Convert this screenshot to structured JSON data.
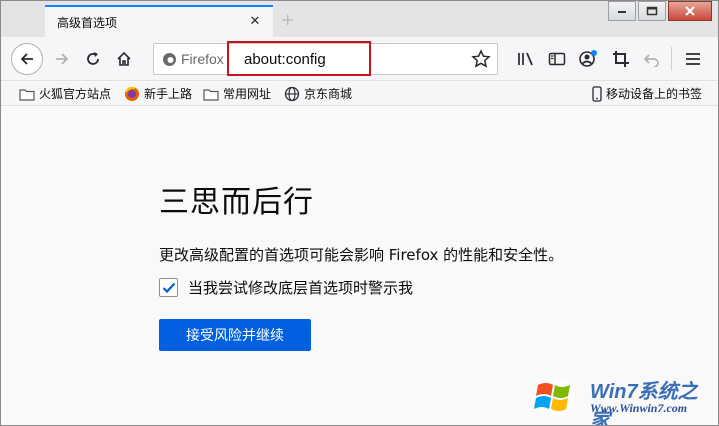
{
  "tab": {
    "title": "高级首选项",
    "close_glyph": "✕",
    "new_tab_glyph": "+"
  },
  "urlbar": {
    "identity_label": "Firefox",
    "url": "about:config"
  },
  "bookmarks": [
    {
      "label": "火狐官方站点",
      "icon": "folder-icon"
    },
    {
      "label": "新手上路",
      "icon": "firefox-icon"
    },
    {
      "label": "常用网址",
      "icon": "folder-icon"
    },
    {
      "label": "京东商城",
      "icon": "globe-icon"
    }
  ],
  "mobile_bookmarks": {
    "label": "移动设备上的书签",
    "icon": "phone-icon"
  },
  "warning": {
    "title": "三思而后行",
    "description": "更改高级配置的首选项可能会影响 Firefox 的性能和安全性。",
    "checkbox_label": "当我尝试修改底层首选项时警示我",
    "checkbox_checked": true,
    "accept_button": "接受风险并继续"
  },
  "watermark": {
    "logo_text": "Win7系统之家",
    "url_text": "Www.Winwin7.com"
  },
  "colors": {
    "accent": "#0060df",
    "highlight_box": "#d0101c",
    "tab_indicator": "#0a84ff"
  }
}
